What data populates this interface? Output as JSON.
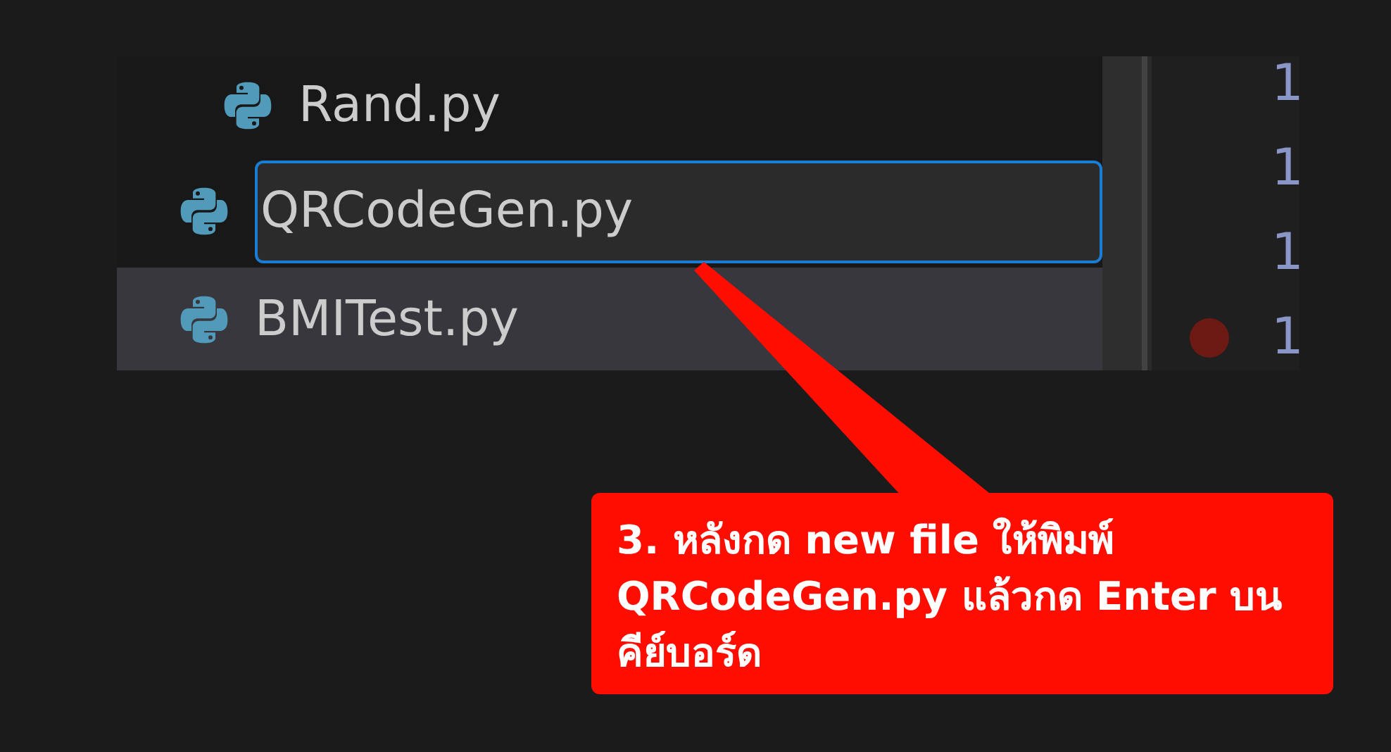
{
  "explorer": {
    "items": [
      {
        "kind": "nested-file",
        "name": "Rand.py",
        "selected": false
      },
      {
        "kind": "rename",
        "name": "QRCodeGen.py",
        "selected": false
      },
      {
        "kind": "file",
        "name": "BMITest.py",
        "selected": true
      }
    ]
  },
  "editor": {
    "lines": [
      {
        "number": "1",
        "breakpoint": false
      },
      {
        "number": "1",
        "breakpoint": false
      },
      {
        "number": "1",
        "breakpoint": false
      },
      {
        "number": "1",
        "breakpoint": true
      }
    ]
  },
  "callout": {
    "text": "3. หลังกด new file ให้พิมพ์ QRCodeGen.py แล้วกด Enter บน คีย์บอร์ด"
  }
}
